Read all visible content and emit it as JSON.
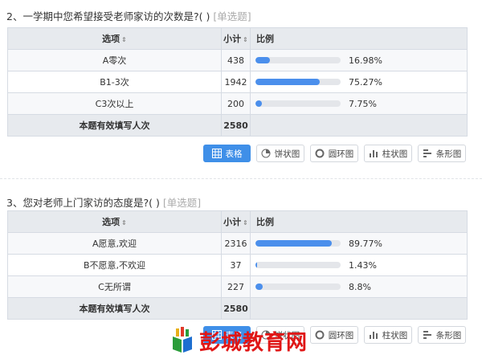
{
  "questions": [
    {
      "title": "2、一学期中您希望接受老师家访的次数是?( )",
      "type": "[单选题]",
      "headers": {
        "option": "选项",
        "count": "小计",
        "ratio": "比例",
        "sort_icon": "⇕"
      },
      "rows": [
        {
          "option": "A零次",
          "count": "438",
          "percent": "16.98%",
          "ratio": 0.1698
        },
        {
          "option": "B1-3次",
          "count": "1942",
          "percent": "75.27%",
          "ratio": 0.7527
        },
        {
          "option": "C3次以上",
          "count": "200",
          "percent": "7.75%",
          "ratio": 0.0775
        }
      ],
      "total_label": "本题有效填写人次",
      "total_value": "2580"
    },
    {
      "title": "3、您对老师上门家访的态度是?( )",
      "type": "[单选题]",
      "headers": {
        "option": "选项",
        "count": "小计",
        "ratio": "比例",
        "sort_icon": "⇕"
      },
      "rows": [
        {
          "option": "A愿意,欢迎",
          "count": "2316",
          "percent": "89.77%",
          "ratio": 0.8977
        },
        {
          "option": "B不愿意,不欢迎",
          "count": "37",
          "percent": "1.43%",
          "ratio": 0.0143
        },
        {
          "option": "C无所谓",
          "count": "227",
          "percent": "8.8%",
          "ratio": 0.088
        }
      ],
      "total_label": "本题有效填写人次",
      "total_value": "2580"
    }
  ],
  "view_buttons": {
    "table": "表格",
    "pie": "饼状图",
    "donut": "圆环图",
    "column": "柱状图",
    "bar": "条形图"
  },
  "watermark": {
    "text": "彭城教育网"
  },
  "colors": {
    "accent": "#3f8fe8",
    "bar": "#4b8fec",
    "track": "#e4e6ea",
    "header_bg": "#e7eaee",
    "watermark": "#e01616"
  }
}
